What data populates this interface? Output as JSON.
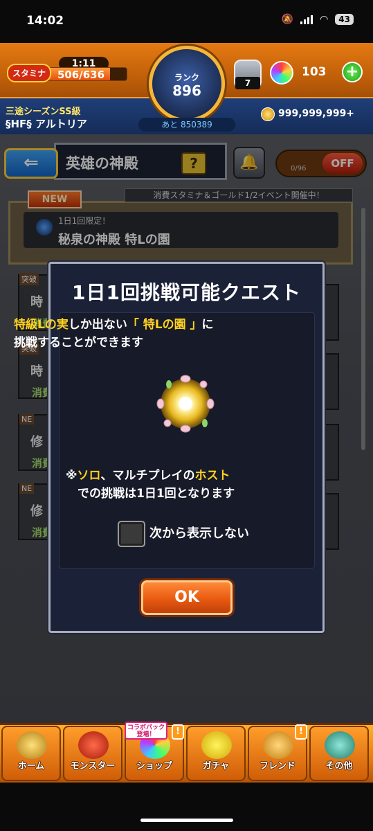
{
  "status_bar": {
    "time": "14:02",
    "battery": "43"
  },
  "header": {
    "stamina_label": "スタミナ",
    "stamina_timer": "1:11",
    "stamina_value": "506/636",
    "stamina_fraction": 0.8,
    "rank_label": "ランク",
    "rank_value": "896",
    "rank_next": "あと 850389",
    "item_count": "7",
    "orb_count": "103",
    "plus_label": "+",
    "player_rank": "三途シーズンSS級",
    "player_name": "§HF§ アルトリア",
    "gold": "999,999,999+"
  },
  "screen": {
    "title": "英雄の神殿",
    "help_label": "?",
    "toggle_count": "0/96",
    "toggle_label": "OFF",
    "event_banner": "消費スタミナ＆ゴールド1/2イベント開催中！",
    "new_tag": "NEW",
    "featured_quest": {
      "small": "1日1回限定！",
      "name": "秘泉の神殿 特Lの園"
    },
    "side_cards": [
      {
        "tag": "突破",
        "title": "時",
        "sub": "消費"
      },
      {
        "tag": "突破",
        "title": "時",
        "sub": "消費"
      },
      {
        "tag": "NE",
        "title": "修",
        "sub": "消費"
      },
      {
        "tag": "NE",
        "title": "修",
        "sub": "消費"
      }
    ]
  },
  "modal": {
    "title": "1日1回挑戦可能クエスト",
    "desc_part1": "特級Lの実",
    "desc_part2": "しか出ない",
    "desc_part3": "「 特Lの園 」",
    "desc_part4": "に",
    "desc_line2": "挑戦することができます",
    "note_prefix": "※",
    "note_solo": "ソロ",
    "note_mid": "、マルチプレイの",
    "note_host": "ホスト",
    "note_line2": "での挑戦は1日1回となります",
    "checkbox_label": "次から表示しない",
    "ok_label": "OK"
  },
  "bottom_nav": {
    "items": [
      {
        "label": "ホーム"
      },
      {
        "label": "モンスター"
      },
      {
        "label": "ショップ"
      },
      {
        "label": "ガチャ"
      },
      {
        "label": "フレンド"
      },
      {
        "label": "その他"
      }
    ],
    "collab_tag_line1": "コラボパック",
    "collab_tag_line2": "登場！",
    "alert_mark": "!"
  },
  "colors": {
    "accent_yellow": "#ffd21f",
    "header_orange": "#e57a12",
    "ok_orange": "#e85a10"
  }
}
